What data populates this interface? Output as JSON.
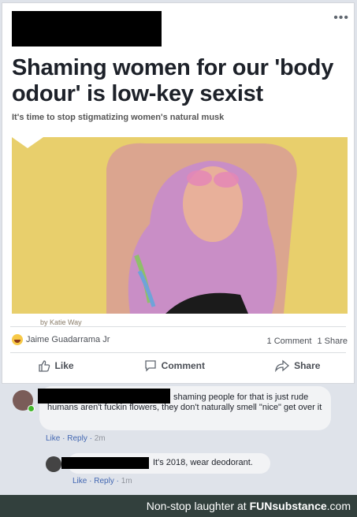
{
  "article": {
    "headline": "Shaming women for our 'body odour' is low-key sexist",
    "subhead": "It's time to stop stigmatizing women's natural musk",
    "byline": "by Katie Way"
  },
  "reactions": {
    "name": "Jaime Guadarrama Jr",
    "comments": "1 Comment",
    "shares": "1 Share"
  },
  "actions": {
    "like": "Like",
    "comment": "Comment",
    "share": "Share"
  },
  "comments": [
    {
      "text": "shaming people for that is just rude humans aren't fuckin flowers, they don't naturally smell \"nice\" get over it",
      "like": "Like",
      "reply": "Reply",
      "time": "2m"
    },
    {
      "text": "It's 2018, wear deodorant.",
      "like": "Like",
      "reply": "Reply",
      "time": "1m"
    }
  ],
  "footer": {
    "prefix": "Non-stop laughter at",
    "brand": "FUNsubstance",
    "suffix": ".com"
  }
}
